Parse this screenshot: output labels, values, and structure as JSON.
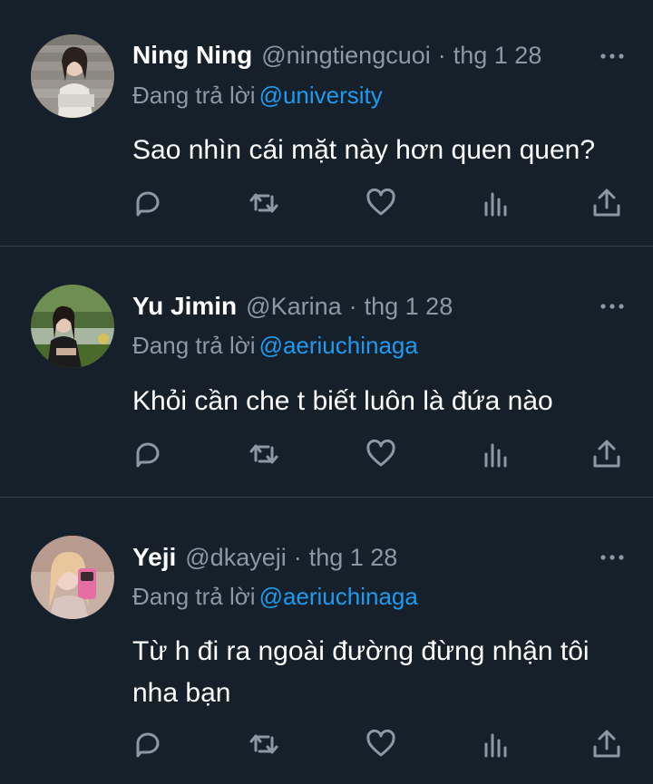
{
  "tweets": [
    {
      "name": "Ning Ning",
      "handle": "@ningtiengcuoi",
      "separator": "·",
      "time": "thg 1 28",
      "reply_prefix": "Đang trả lời",
      "reply_to": "@university",
      "lines": [
        "Sao nhìn cái mặt này hơn quen quen?"
      ]
    },
    {
      "name": "Yu Jimin",
      "handle": "@Karina",
      "separator": "·",
      "time": "thg 1 28",
      "reply_prefix": "Đang trả lời",
      "reply_to": "@aeriuchinaga",
      "lines": [
        "Khỏi cần che t biết luôn là đứa nào"
      ]
    },
    {
      "name": "Yeji",
      "handle": "@dkayeji",
      "separator": "·",
      "time": "thg 1 28",
      "reply_prefix": "Đang trả lời",
      "reply_to": "@aeriuchinaga",
      "lines": [
        "Từ h đi ra ngoài đường đừng nhận tôi",
        "nha bạn"
      ]
    }
  ],
  "icons": {
    "more": "more-horizontal-icon",
    "reply": "reply-icon",
    "retweet": "retweet-icon",
    "like": "heart-icon",
    "views": "analytics-icon",
    "share": "share-icon"
  },
  "colors": {
    "background": "#15202b",
    "secondary_text": "#8b98a5",
    "mention": "#1d9bf0",
    "divider": "#38444d"
  }
}
